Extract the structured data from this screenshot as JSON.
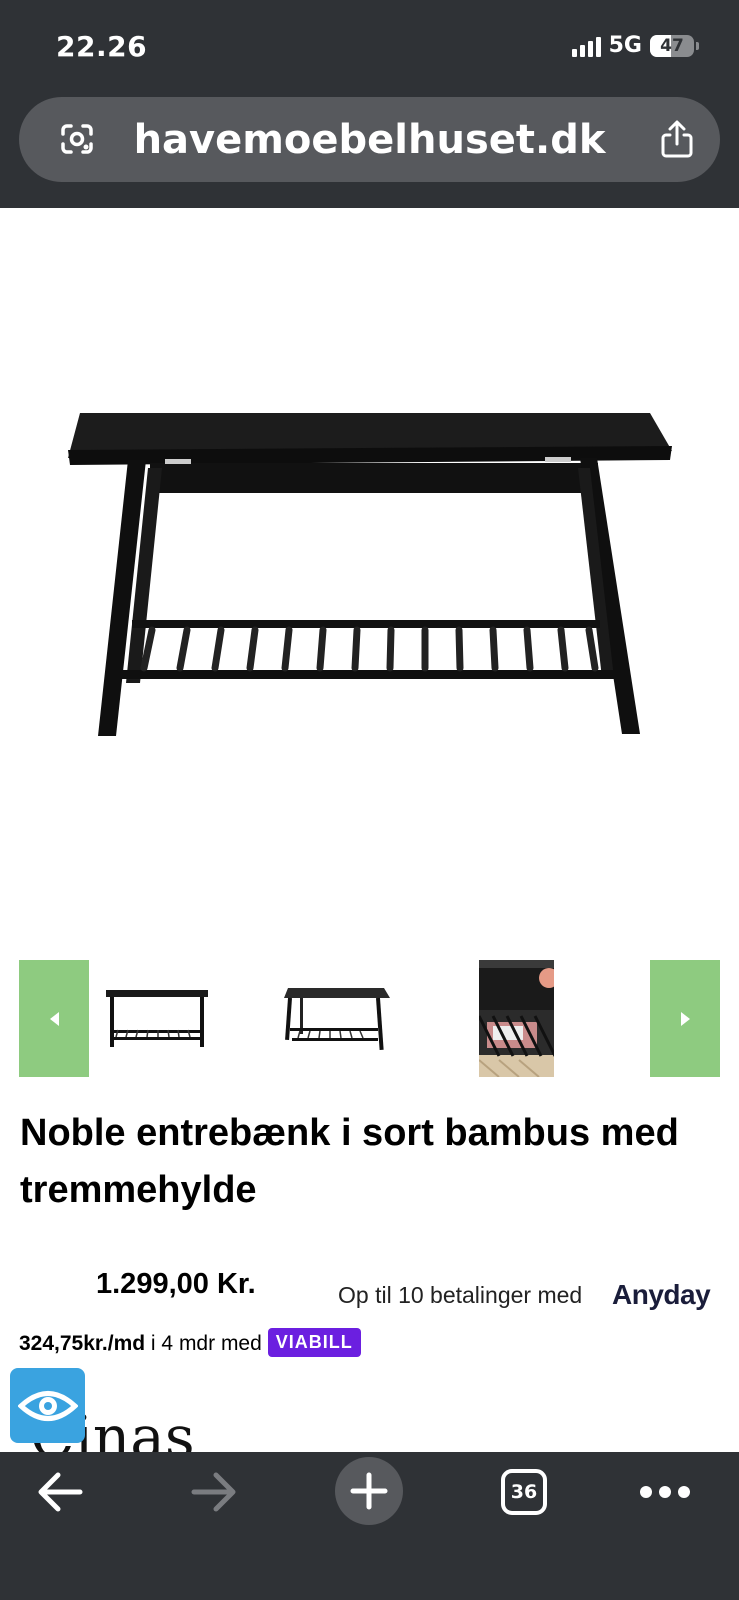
{
  "status_bar": {
    "time": "22.26",
    "network": "5G",
    "battery": "47"
  },
  "browser": {
    "url": "havemoebelhuset.dk",
    "tab_count": "36"
  },
  "product": {
    "title": "Noble entrebænk i sort bambus med tremmehylde",
    "price": "1.299,00 Kr.",
    "anyday_text": "Op til 10 betalinger med",
    "anyday_logo": "Anyday",
    "monthly_amount": "324,75kr./md",
    "monthly_rest": " i 4 mdr med",
    "viabill_logo": "VIABILL"
  },
  "partial_logo": "Cinas",
  "icons": {
    "lens": "google-lens-icon",
    "share": "share-icon",
    "back": "back-arrow-icon",
    "forward": "forward-arrow-icon",
    "new_tab": "plus-icon",
    "more": "more-dots-icon",
    "accessibility": "eye-icon"
  },
  "colors": {
    "chrome_bg": "#2f3236",
    "url_bar_bg": "#57595d",
    "carousel_arrow": "#8ecb80",
    "viabill": "#6b1fe0",
    "accessibility_badge": "#3aa3e0"
  }
}
